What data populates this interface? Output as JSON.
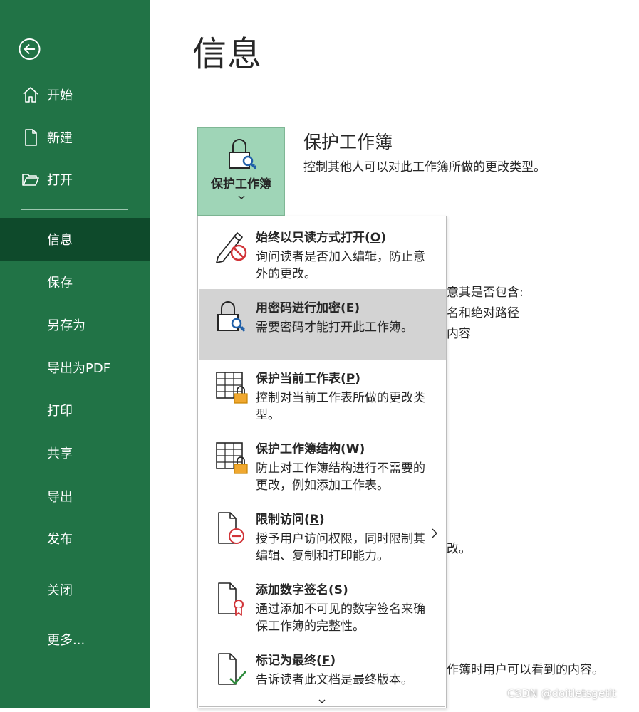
{
  "sidebar": {
    "back_icon": "back-arrow-icon",
    "top_items": [
      {
        "label": "开始",
        "icon": "home-icon"
      },
      {
        "label": "新建",
        "icon": "new-document-icon"
      },
      {
        "label": "打开",
        "icon": "open-folder-icon"
      }
    ],
    "items": [
      {
        "label": "信息",
        "selected": true
      },
      {
        "label": "保存"
      },
      {
        "label": "另存为"
      },
      {
        "label": "导出为PDF"
      },
      {
        "label": "打印"
      },
      {
        "label": "共享"
      },
      {
        "label": "导出"
      },
      {
        "label": "发布"
      },
      {
        "label": "关闭"
      },
      {
        "label": "更多..."
      }
    ],
    "bg_color": "#217346",
    "selected_color": "#0e4a2b"
  },
  "main": {
    "title": "信息",
    "protect": {
      "button_label": "保护工作簿",
      "heading": "保护工作簿",
      "description": "控制其他人可以对此工作簿所做的更改类型。"
    },
    "background_text": {
      "line1": "意其是否包含:",
      "line2": "名和绝对路径",
      "line3": "内容",
      "line4": "改。",
      "line5": "作簿时用户可以看到的内容。"
    }
  },
  "dropdown": {
    "items": [
      {
        "title": "始终以只读方式打开(O)",
        "title_main": "始终以只读方式打开(",
        "key": "O",
        "title_end": ")",
        "desc": "询问读者是否加入编辑，防止意外的更改。",
        "icon": "pencil-no-edit-icon"
      },
      {
        "title": "用密码进行加密(E)",
        "title_main": "用密码进行加密(",
        "key": "E",
        "title_end": ")",
        "desc": "需要密码才能打开此工作簿。",
        "icon": "lock-key-icon",
        "hovered": true
      },
      {
        "title": "保护当前工作表(P)",
        "title_main": "保护当前工作表(",
        "key": "P",
        "title_end": ")",
        "desc": "控制对当前工作表所做的更改类型。",
        "icon": "sheet-lock-icon"
      },
      {
        "title": "保护工作簿结构(W)",
        "title_main": "保护工作簿结构(",
        "key": "W",
        "title_end": ")",
        "desc": "防止对工作簿结构进行不需要的更改，例如添加工作表。",
        "icon": "workbook-structure-lock-icon"
      },
      {
        "title": "限制访问(R)",
        "title_main": "限制访问(",
        "key": "R",
        "title_end": ")",
        "desc": "授予用户访问权限，同时限制其编辑、复制和打印能力。",
        "icon": "restrict-access-icon",
        "has_submenu": true
      },
      {
        "title": "添加数字签名(S)",
        "title_main": "添加数字签名(",
        "key": "S",
        "title_end": ")",
        "desc": "通过添加不可见的数字签名来确保工作簿的完整性。",
        "icon": "digital-signature-icon"
      },
      {
        "title": "标记为最终(F)",
        "title_main": "标记为最终(",
        "key": "F",
        "title_end": ")",
        "desc": "告诉读者此文档是最终版本。",
        "icon": "mark-final-icon"
      }
    ],
    "scroll_icon": "chevron-down-icon"
  },
  "watermark": "CSDN @doitletsgetit"
}
